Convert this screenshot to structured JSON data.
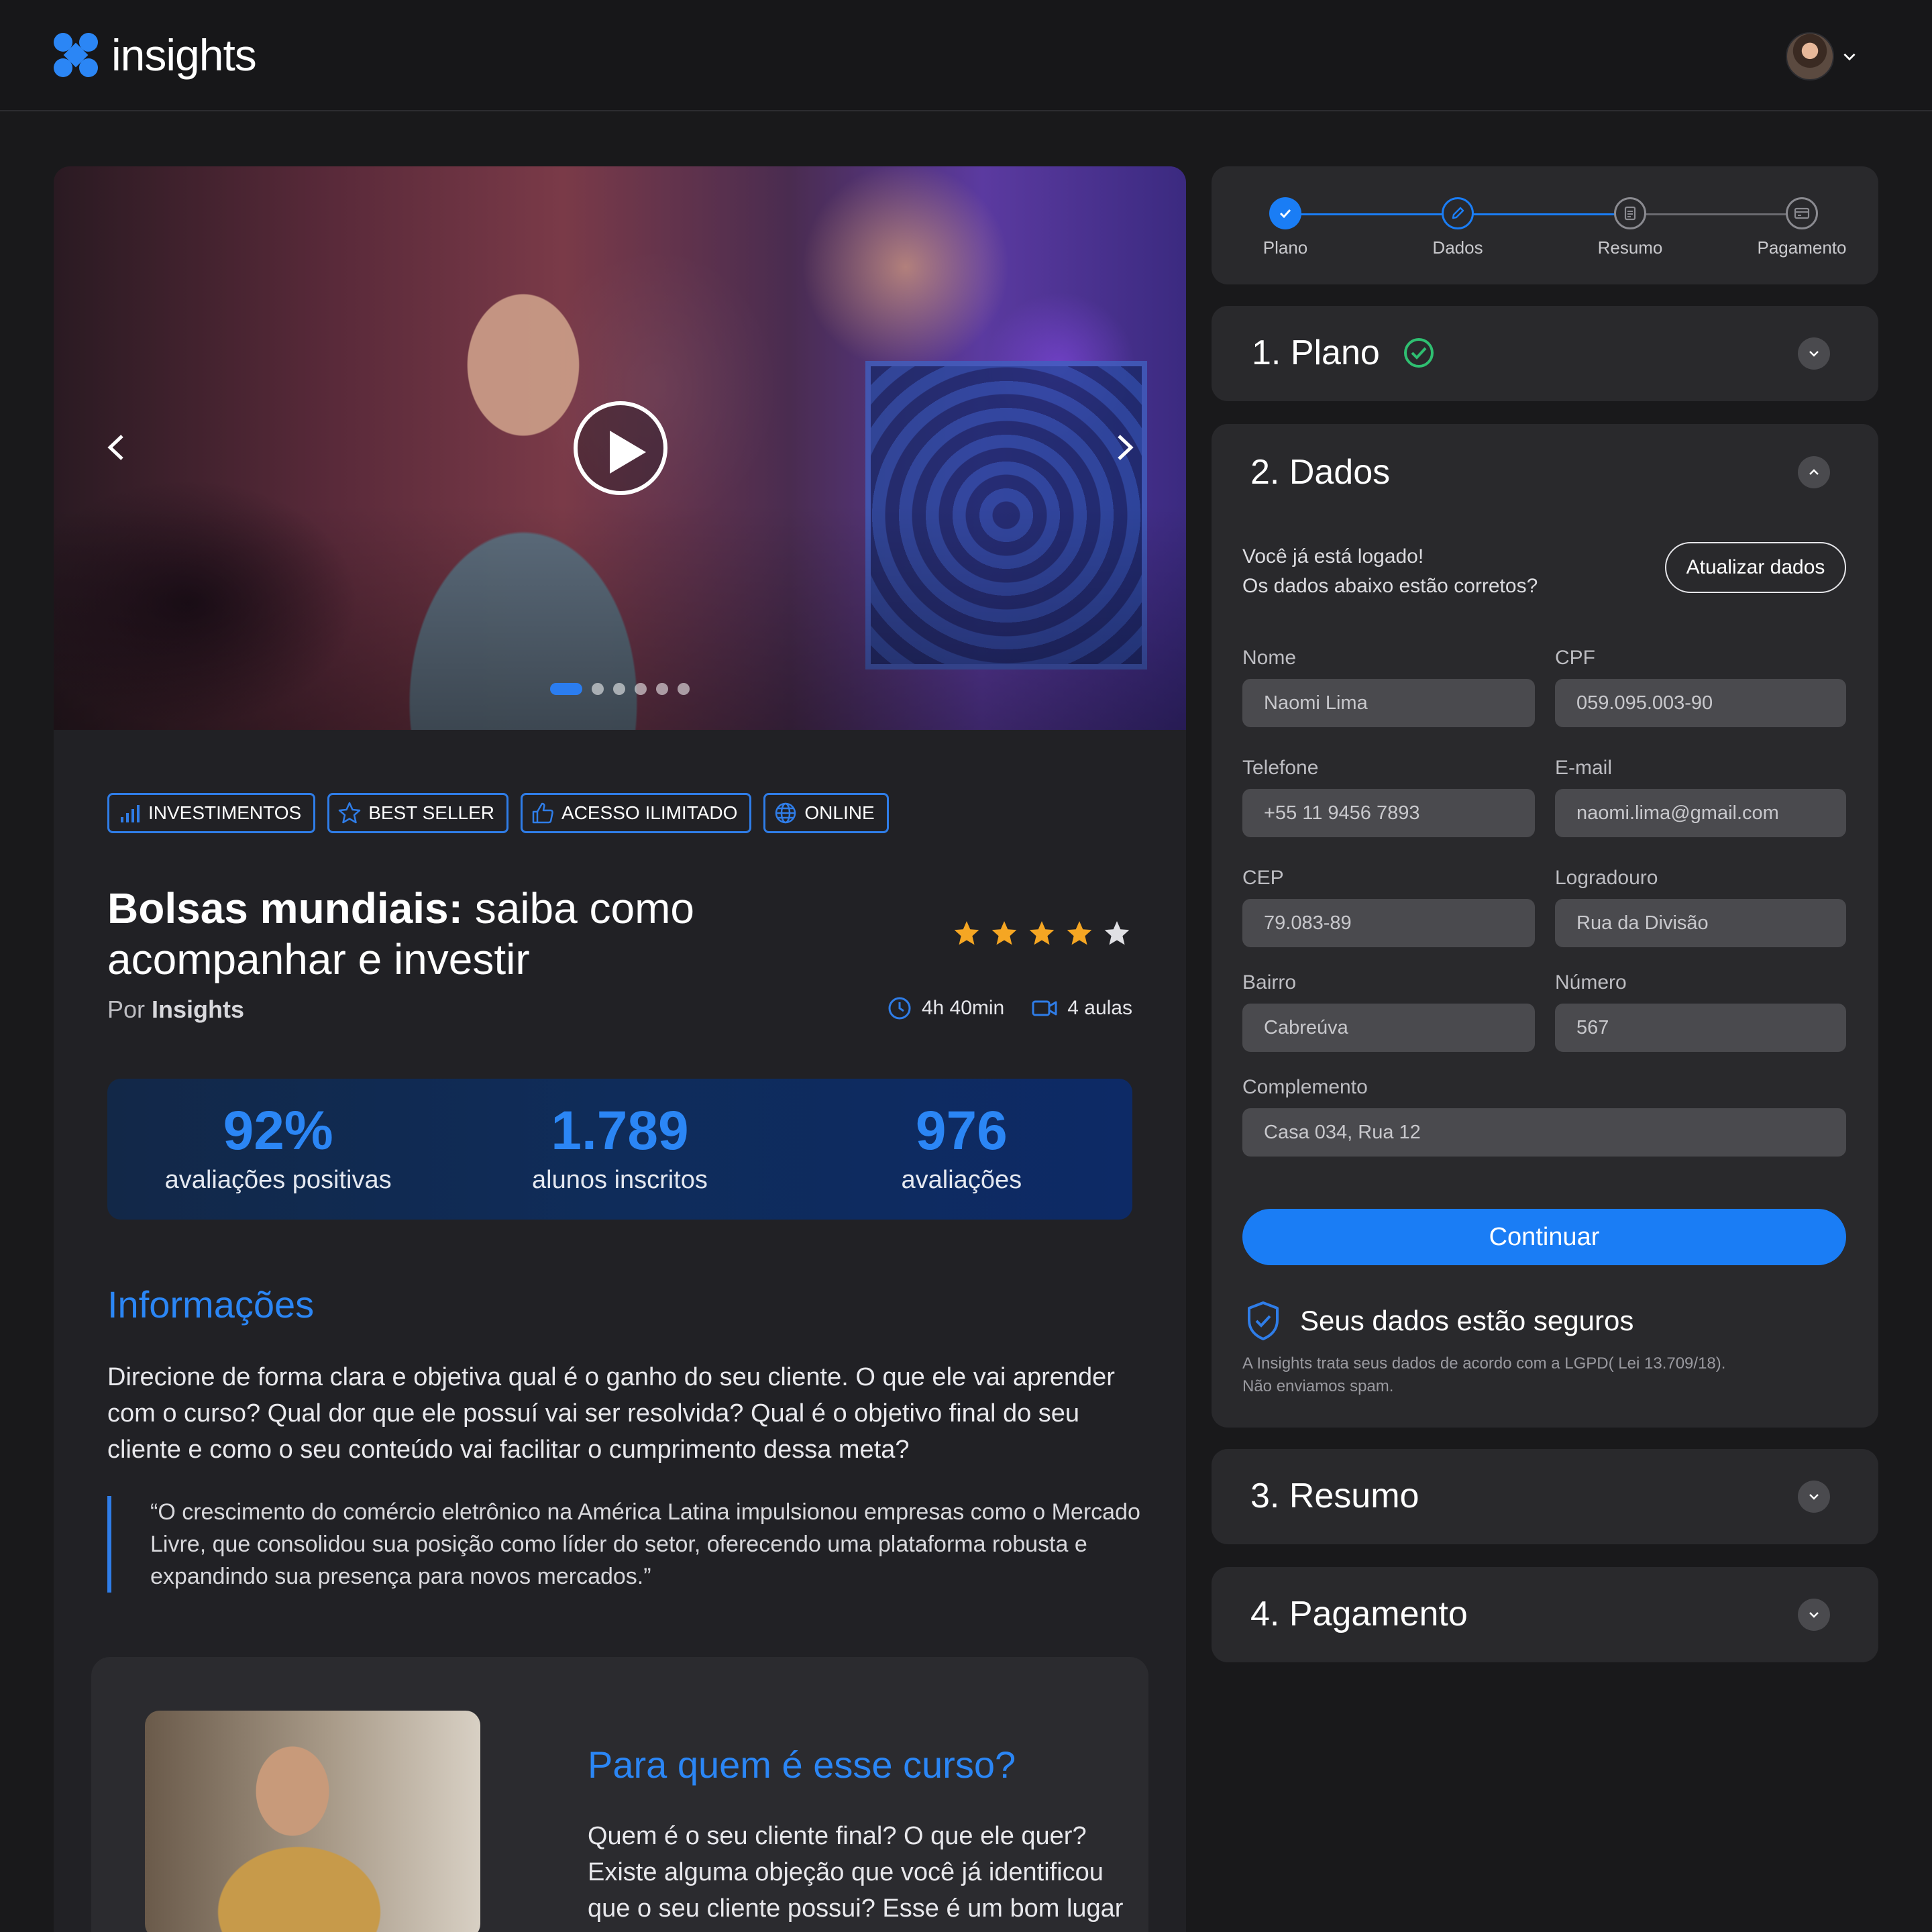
{
  "header": {
    "brand": "insights",
    "brand_color": "#2b86f5"
  },
  "course": {
    "carousel": {
      "slide_count": 6,
      "active_slide": 1
    },
    "tags": [
      {
        "label": "INVESTIMENTOS",
        "icon": "bar-chart-icon"
      },
      {
        "label": "BEST SELLER",
        "icon": "star-outline-icon"
      },
      {
        "label": "ACESSO ILIMITADO",
        "icon": "thumbs-up-icon"
      },
      {
        "label": "ONLINE",
        "icon": "globe-icon"
      }
    ],
    "title_bold": "Bolsas mundiais:",
    "title_rest": " saiba como acompanhar e investir",
    "author_prefix": "Por ",
    "author_name": "Insights",
    "rating": {
      "value": 4,
      "max": 5
    },
    "duration": "4h 40min",
    "lessons": "4 aulas",
    "stats": [
      {
        "value": "92%",
        "label": "avaliações positivas"
      },
      {
        "value": "1.789",
        "label": "alunos inscritos"
      },
      {
        "value": "976",
        "label": "avaliações"
      }
    ],
    "info_heading": "Informações",
    "info_text": "Direcione de forma clara e objetiva qual é o ganho do seu cliente. O que ele vai aprender com o curso? Qual dor que ele possuí vai ser resolvida? Qual é o objetivo final do seu cliente e como o seu conteúdo vai facilitar o cumprimento dessa meta?",
    "quote": "“O crescimento do comércio eletrônico na América Latina impulsionou empresas como o Mercado Livre, que consolidou sua posição como líder do setor, oferecendo uma plataforma robusta e expandindo sua presença para novos mercados.”",
    "for_heading": "Para quem é esse curso?",
    "for_text": "Quem é o seu cliente final? O que ele quer? Existe alguma objeção que você já identificou que o seu cliente possui? Esse é um bom lugar para tentar"
  },
  "checkout": {
    "steps": [
      {
        "label": "Plano",
        "state": "done",
        "icon": "check-icon"
      },
      {
        "label": "Dados",
        "state": "current",
        "icon": "pencil-icon"
      },
      {
        "label": "Resumo",
        "state": "pending",
        "icon": "document-icon"
      },
      {
        "label": "Pagamento",
        "state": "pending",
        "icon": "card-icon"
      }
    ],
    "sections": {
      "plano": "1. Plano",
      "dados": "2. Dados",
      "resumo": "3. Resumo",
      "pagamento": "4. Pagamento"
    },
    "logged_line1": "Você já está logado!",
    "logged_line2": "Os dados abaixo estão corretos?",
    "update_button": "Atualizar dados",
    "fields": {
      "nome": {
        "label": "Nome",
        "value": "Naomi Lima"
      },
      "cpf": {
        "label": "CPF",
        "value": "059.095.003-90"
      },
      "telefone": {
        "label": "Telefone",
        "value": "+55 11 9456 7893"
      },
      "email": {
        "label": "E-mail",
        "value": "naomi.lima@gmail.com"
      },
      "cep": {
        "label": "CEP",
        "value": "79.083-89"
      },
      "logradouro": {
        "label": "Logradouro",
        "value": "Rua da Divisão"
      },
      "bairro": {
        "label": "Bairro",
        "value": "Cabreúva"
      },
      "numero": {
        "label": "Número",
        "value": "567"
      },
      "complemento": {
        "label": "Complemento",
        "value": "Casa 034, Rua 12"
      }
    },
    "continue_button": "Continuar",
    "secure_title": "Seus dados estão seguros",
    "secure_note_line1": "A Insights trata seus dados de acordo com a LGPD( Lei 13.709/18).",
    "secure_note_line2": "Não enviamos spam."
  },
  "colors": {
    "accent": "#1a7df5",
    "success": "#2fbf71",
    "star": "#f5a623",
    "star_empty": "#e0e0e4"
  }
}
